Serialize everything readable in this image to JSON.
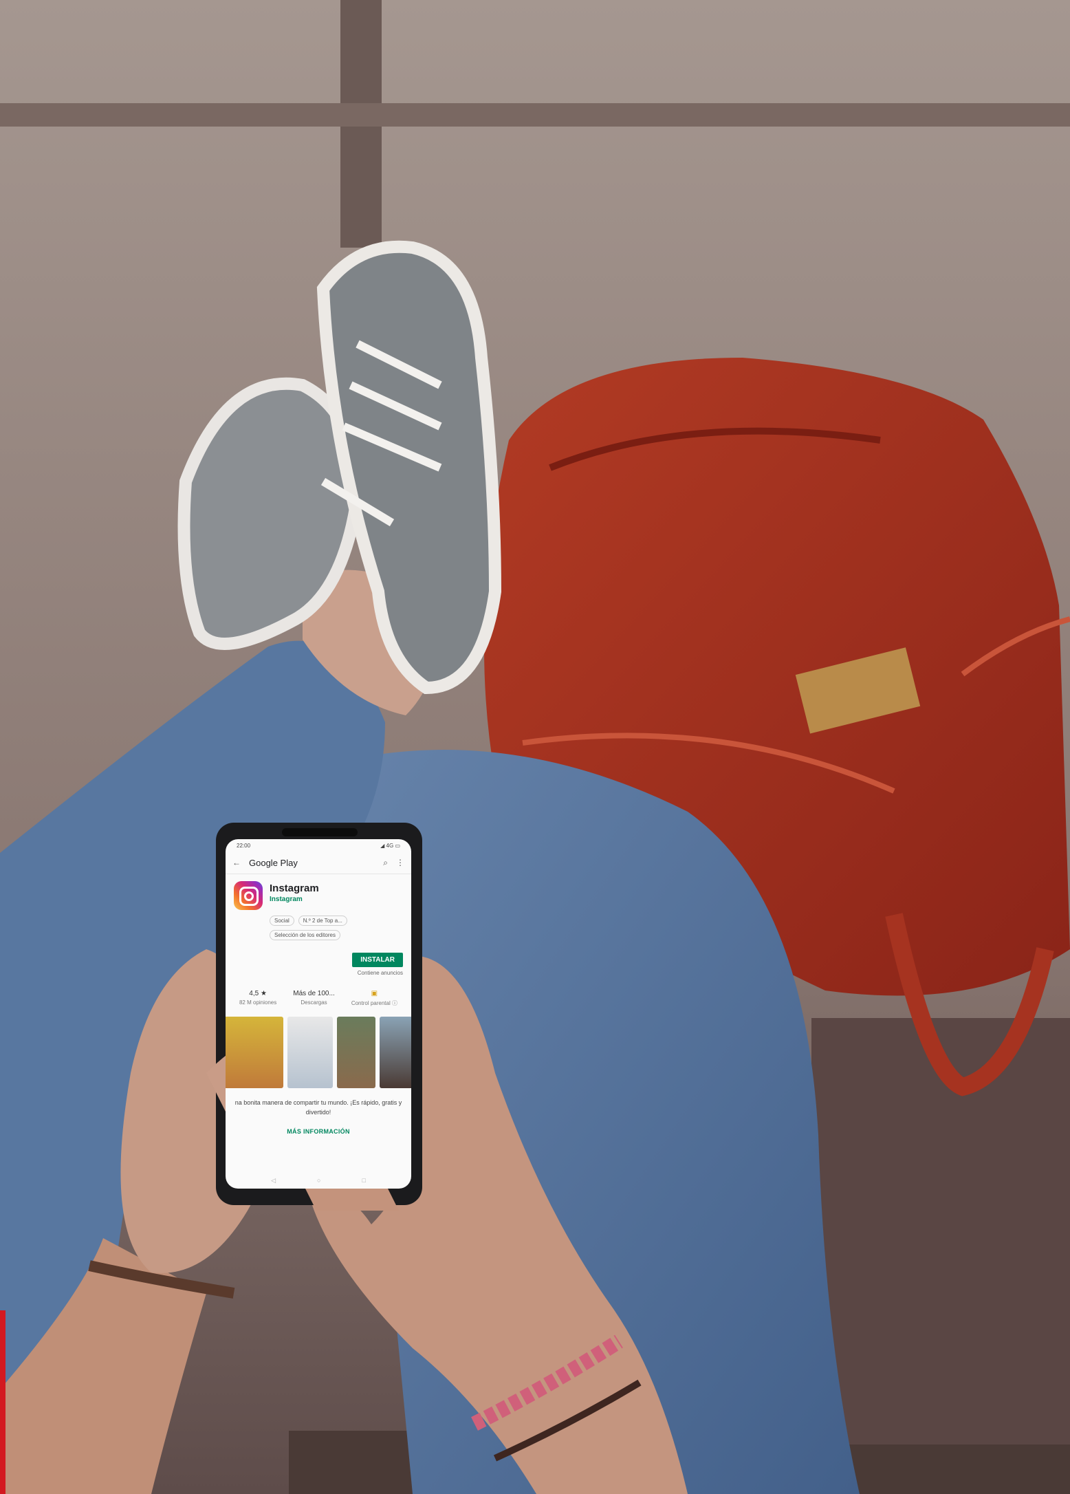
{
  "photo": {
    "description_colors": {
      "floor": "#8e7d76",
      "jeans": "#56739a",
      "backpack": "#b0341f",
      "skin": "#c59781",
      "sneaker": "#8b8f93"
    }
  },
  "phone": {
    "status_time": "22:00",
    "status_icons": "◢ 4G ▭",
    "appbar": {
      "back": "←",
      "title": "Google Play",
      "search": "⌕",
      "menu": "⋮"
    },
    "app": {
      "title": "Instagram",
      "developer": "Instagram",
      "chips": [
        "Social",
        "N.º 2 de Top a...",
        "Selección de los editores"
      ],
      "install_label": "INSTALAR",
      "ads_note": "Contiene anuncios"
    },
    "stats": [
      {
        "value": "4,5 ★",
        "label": "82 M opiniones"
      },
      {
        "value": "Más de 100...",
        "label": "Descargas"
      },
      {
        "value": "▣",
        "label": "Control parental ⓘ"
      }
    ],
    "description": "na bonita manera de compartir tu mundo. ¡Es rápido, gratis y divertido!",
    "more_label": "MÁS INFORMACIÓN",
    "nav": [
      "◁",
      "○",
      "□"
    ]
  }
}
